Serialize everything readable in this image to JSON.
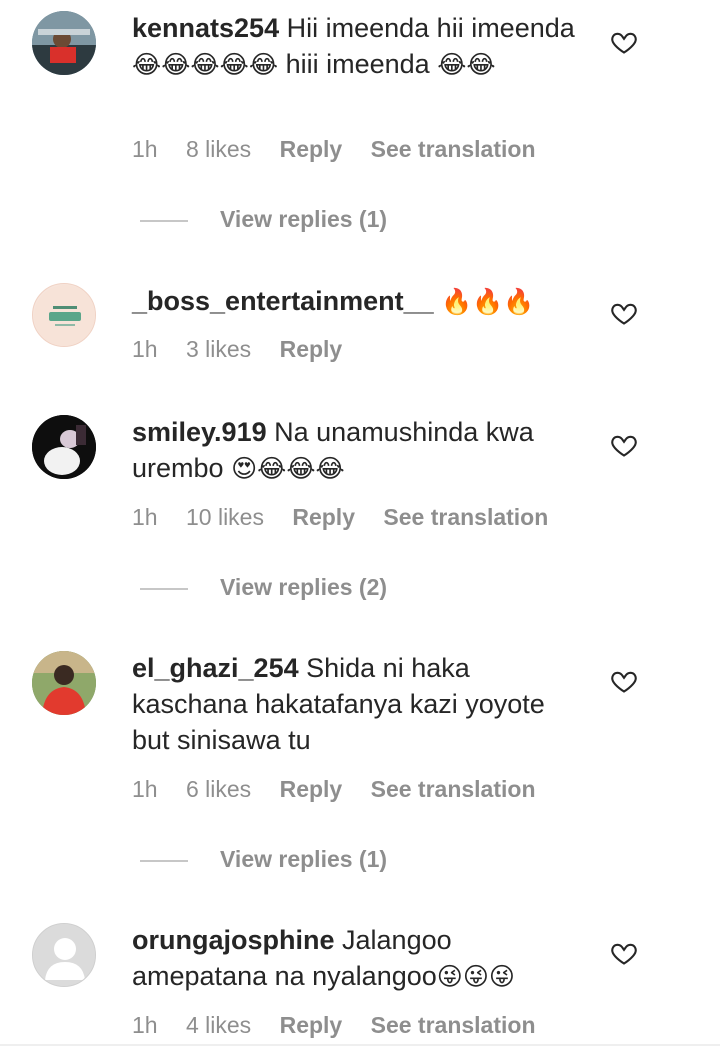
{
  "colors": {
    "text": "#262626",
    "meta": "#8e8e8e",
    "divider": "#c7c7c7"
  },
  "comments": [
    {
      "username": "kennats254",
      "text_part1": "Hii imeenda hii imeenda",
      "emojis1": "😂😂😂😂😂",
      "text_part2": "hiii imeenda",
      "emojis2": "😂😂",
      "time": "1h",
      "likes": "8 likes",
      "reply": "Reply",
      "translation": "See translation",
      "view_replies": "View replies (1)",
      "avatar_icon": "car-profile-avatar"
    },
    {
      "username": "_boss_entertainment__",
      "emojis1": "🔥🔥🔥",
      "time": "1h",
      "likes": "3 likes",
      "reply": "Reply",
      "avatar_icon": "boss-logo-avatar"
    },
    {
      "username": "smiley.919",
      "text_part1": "Na unamushinda kwa urembo",
      "emojis1": "😍😂😂😂",
      "time": "1h",
      "likes": "10 likes",
      "reply": "Reply",
      "translation": "See translation",
      "view_replies": "View replies (2)",
      "avatar_icon": "person-photo-avatar"
    },
    {
      "username": "el_ghazi_254",
      "text_part1": "Shida ni haka kaschana hakatafanya kazi yoyote but sinisawa tu",
      "time": "1h",
      "likes": "6 likes",
      "reply": "Reply",
      "translation": "See translation",
      "view_replies": "View replies (1)",
      "avatar_icon": "man-red-shirt-avatar"
    },
    {
      "username": "orungajosphine",
      "text_part1": "Jalangoo amepatana na nyalangoo",
      "emojis1": "😜😜😜",
      "time": "1h",
      "likes": "4 likes",
      "reply": "Reply",
      "translation": "See translation",
      "avatar_icon": "default-user-avatar"
    }
  ]
}
